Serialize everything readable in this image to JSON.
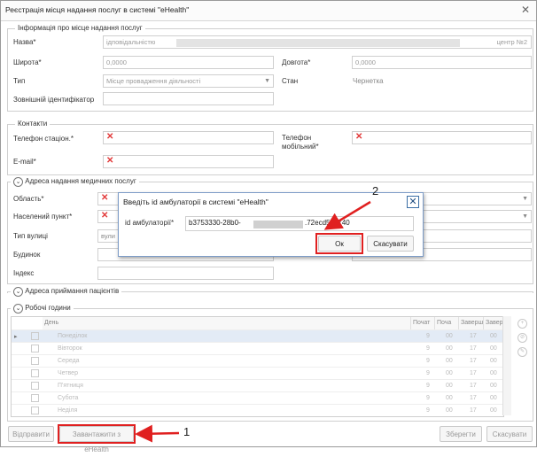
{
  "window": {
    "title": "Реєстрація місця надання послуг в системі \"eHealth\""
  },
  "info_group": {
    "legend": "Інформація про місце надання послуг",
    "name_label": "Назва*",
    "name_value_start": "ідповідальністю",
    "name_value_end": "центр №2",
    "lat_label": "Широта*",
    "lat_value": "0,0000",
    "lon_label": "Довгота*",
    "lon_value": "0,0000",
    "type_label": "Тип",
    "type_value": "Місце провадження діяльності",
    "state_label": "Стан",
    "state_value": "Чернетка",
    "ext_id_label": "Зовнішній ідентифікатор"
  },
  "contacts_group": {
    "legend": "Контакти",
    "phone_label": "Телефон стаціон.*",
    "mobile_label_1": "Телефон",
    "mobile_label_2": "мобільний*",
    "email_label": "E-mail*",
    "error_mark": "✕"
  },
  "address_group": {
    "legend": "Адреса надання медичних послуг",
    "region_label": "Область*",
    "city_label": "Населений пункт*",
    "street_type_label": "Тип вулиці",
    "street_type_value": "вули",
    "building_label": "Будинок",
    "index_label": "Індекс"
  },
  "reception_group": {
    "legend": "Адреса приймання пацієнтів"
  },
  "hours_group": {
    "legend": "Робочі години",
    "columns": [
      "День",
      "Почат",
      "Поча",
      "Заверш",
      "Заверш"
    ],
    "rows": [
      {
        "day": "Понеділок",
        "c1": "9",
        "c2": "00",
        "c3": "17",
        "c4": "00"
      },
      {
        "day": "Вівторок",
        "c1": "9",
        "c2": "00",
        "c3": "17",
        "c4": "00"
      },
      {
        "day": "Середа",
        "c1": "9",
        "c2": "00",
        "c3": "17",
        "c4": "00"
      },
      {
        "day": "Четвер",
        "c1": "9",
        "c2": "00",
        "c3": "17",
        "c4": "00"
      },
      {
        "day": "П'ятниця",
        "c1": "9",
        "c2": "00",
        "c3": "17",
        "c4": "00"
      },
      {
        "day": "Субота",
        "c1": "9",
        "c2": "00",
        "c3": "17",
        "c4": "00"
      },
      {
        "day": "Неділя",
        "c1": "9",
        "c2": "00",
        "c3": "17",
        "c4": "00"
      }
    ]
  },
  "footer": {
    "send_label": "Відправити",
    "load_label": "Завантажити з eHealth",
    "save_label": "Зберегти",
    "cancel_label": "Скасувати"
  },
  "dialog": {
    "title": "Введіть id амбулаторії в системі \"eHealth\"",
    "field_label": "id амбулаторії*",
    "field_value_start": "b3753330-28b0-",
    "field_value_end": ".72ecd5ea740",
    "ok_label": "Ок",
    "cancel_label": "Скасувати"
  },
  "annotations": {
    "marker_1": "1",
    "marker_2": "2"
  },
  "colors": {
    "error": "#e23a3a",
    "highlight": "#e02020",
    "dialog_border": "#7d9cc7"
  }
}
